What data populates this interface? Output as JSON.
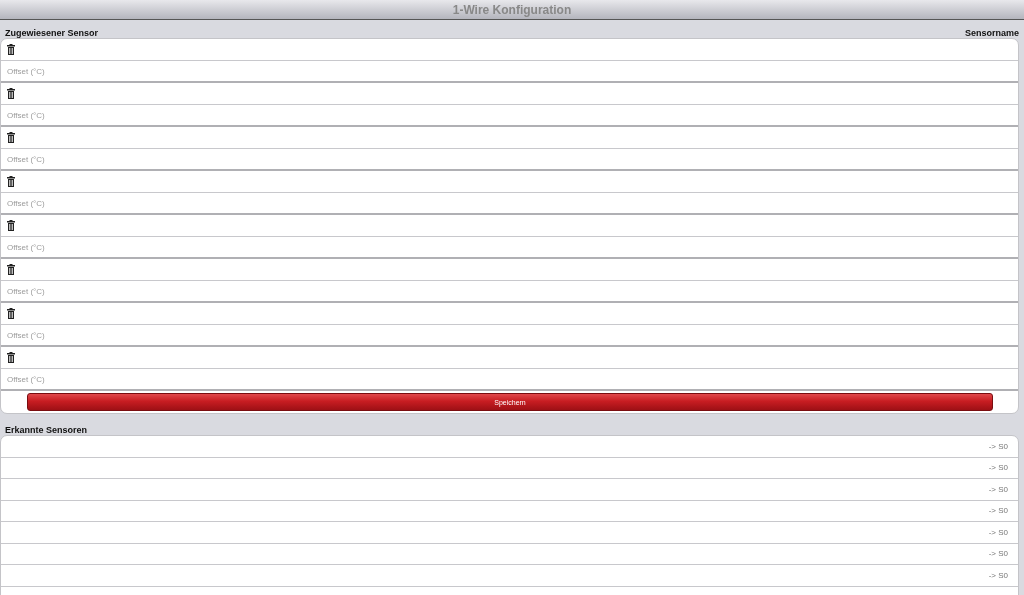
{
  "header": {
    "title": "1-Wire Konfiguration"
  },
  "assigned": {
    "label": "Zugewiesener Sensor",
    "name_label": "Sensorname",
    "sensors": [
      {
        "offset_placeholder": "Offset (°C)"
      },
      {
        "offset_placeholder": "Offset (°C)"
      },
      {
        "offset_placeholder": "Offset (°C)"
      },
      {
        "offset_placeholder": "Offset (°C)"
      },
      {
        "offset_placeholder": "Offset (°C)"
      },
      {
        "offset_placeholder": "Offset (°C)"
      },
      {
        "offset_placeholder": "Offset (°C)"
      },
      {
        "offset_placeholder": "Offset (°C)"
      }
    ],
    "save_button": "Speichern"
  },
  "detected": {
    "label": "Erkannte Sensoren",
    "rows": [
      {
        "target": "-> S0"
      },
      {
        "target": "-> S0"
      },
      {
        "target": "-> S0"
      },
      {
        "target": "-> S0"
      },
      {
        "target": "-> S0"
      },
      {
        "target": "-> S0"
      },
      {
        "target": "-> S0"
      }
    ]
  }
}
